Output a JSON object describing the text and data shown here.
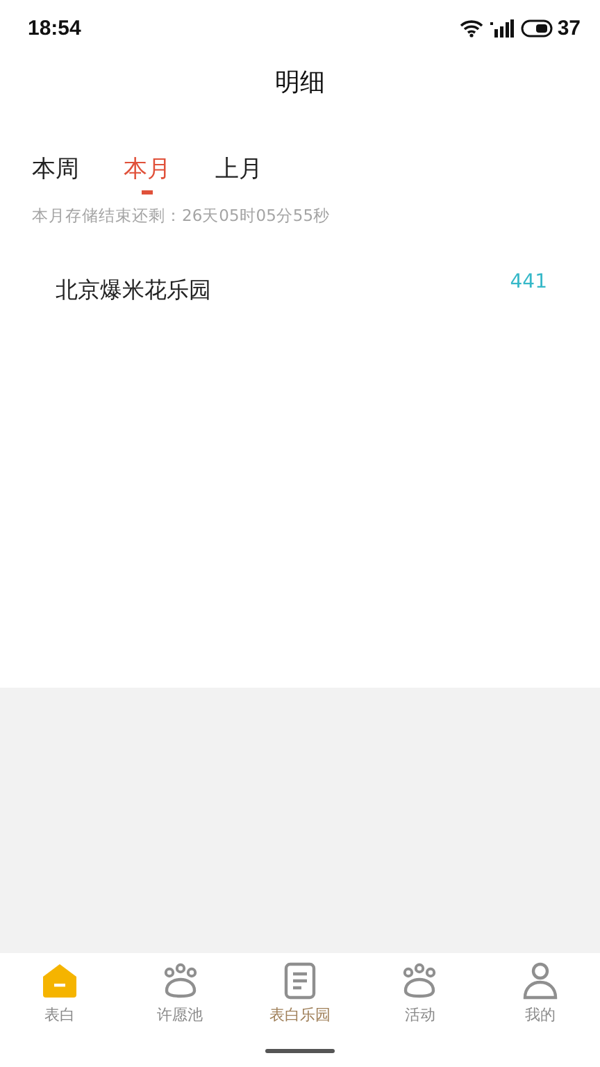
{
  "status_bar": {
    "time": "18:54",
    "battery": "37"
  },
  "title": "明细",
  "tabs": [
    {
      "label": "本周",
      "selected": false
    },
    {
      "label": "本月",
      "selected": true
    },
    {
      "label": "上月",
      "selected": false
    }
  ],
  "countdown": "本月存储结束还剩：26天05时05分55秒",
  "rows": [
    {
      "name": "北京爆米花乐园",
      "value": "441"
    }
  ],
  "nav": [
    {
      "label": "表白",
      "kind": "house",
      "selected": true,
      "color": "#8a8a8a"
    },
    {
      "label": "许愿池",
      "kind": "paw",
      "selected": false,
      "color": "#8a8a8a"
    },
    {
      "label": "表白乐园",
      "kind": "doc",
      "selected": false,
      "color": "#a0805a"
    },
    {
      "label": "活动",
      "kind": "paw",
      "selected": false,
      "color": "#8a8a8a"
    },
    {
      "label": "我的",
      "kind": "person",
      "selected": false,
      "color": "#8a8a8a"
    }
  ]
}
